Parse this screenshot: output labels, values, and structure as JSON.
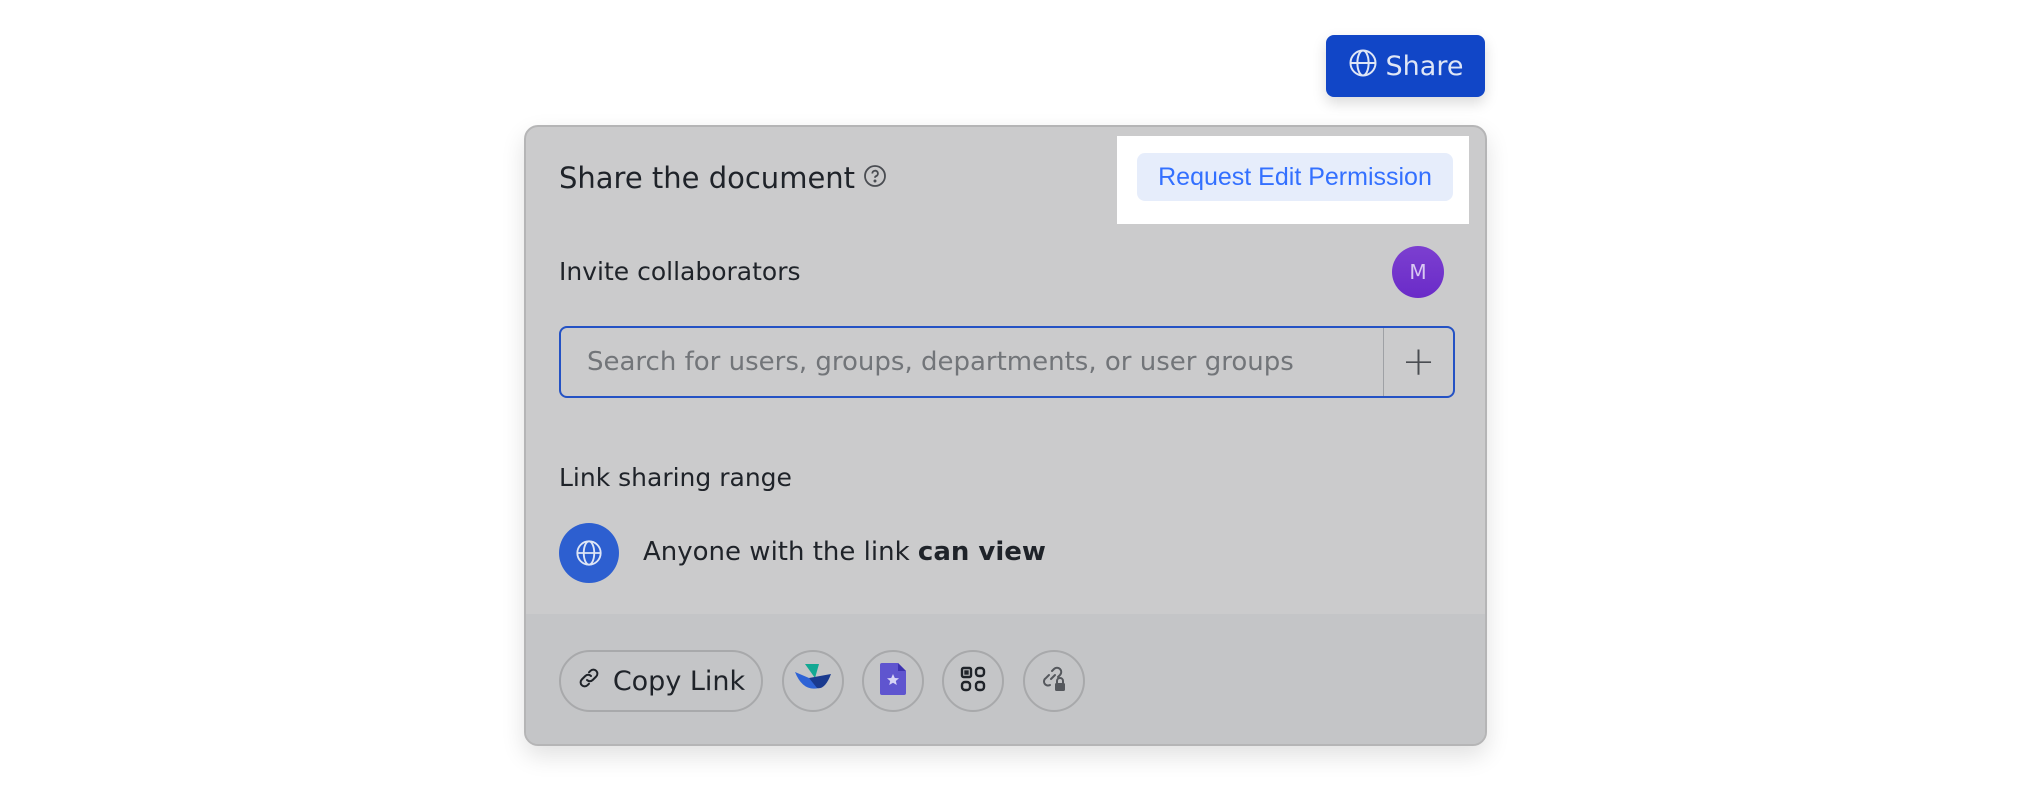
{
  "share_button": {
    "label": "Share",
    "icon": "globe-icon"
  },
  "panel": {
    "title": "Share the document",
    "request_button": "Request Edit Permission",
    "invite_label": "Invite collaborators",
    "avatar_initial": "M",
    "search_placeholder": "Search for users, groups, departments, or user groups",
    "search_value": "",
    "link_range_label": "Link sharing range",
    "range_text": "Anyone with the link ",
    "range_permission": "can view"
  },
  "footer": {
    "copy_link": "Copy Link",
    "actions": [
      "lark-share-icon",
      "doc-star-icon",
      "qr-code-icon",
      "link-lock-icon"
    ]
  },
  "colors": {
    "primary": "#1146c7",
    "link": "#3370ff",
    "avatar": "#6a2bc8"
  }
}
